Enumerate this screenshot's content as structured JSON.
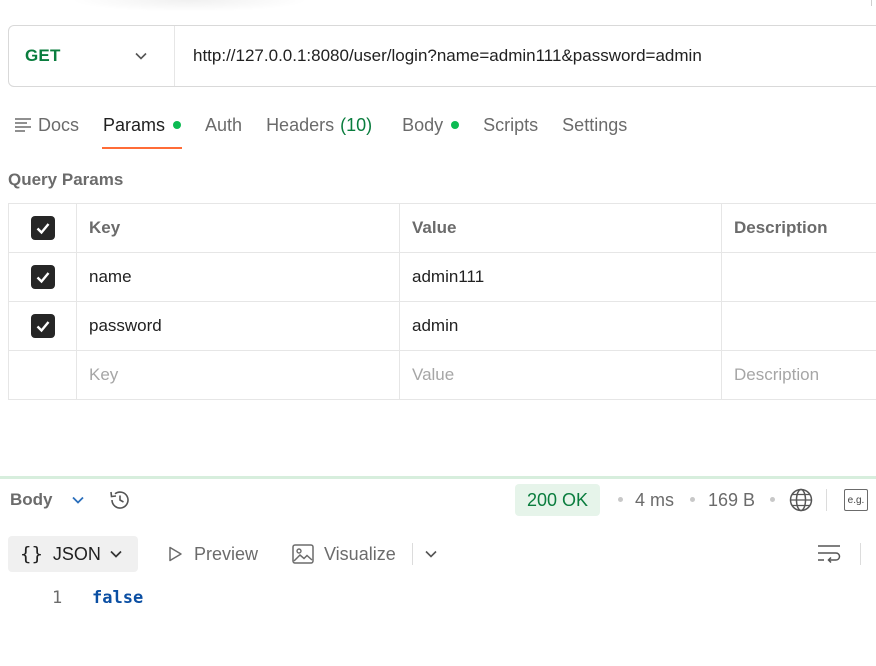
{
  "request": {
    "method": "GET",
    "url": "http://127.0.0.1:8080/user/login?name=admin111&password=admin"
  },
  "tabs": [
    {
      "label": "Docs"
    },
    {
      "label": "Params"
    },
    {
      "label": "Auth"
    },
    {
      "label": "Headers",
      "count": "(10)"
    },
    {
      "label": "Body"
    },
    {
      "label": "Scripts"
    },
    {
      "label": "Settings"
    }
  ],
  "active_tab": "Params",
  "query_params": {
    "title": "Query Params",
    "headers": {
      "key": "Key",
      "value": "Value",
      "description": "Description"
    },
    "rows": [
      {
        "key": "name",
        "value": "admin111",
        "description": "",
        "checked": true
      },
      {
        "key": "password",
        "value": "admin",
        "description": "",
        "checked": true
      }
    ],
    "placeholder": {
      "key": "Key",
      "value": "Value",
      "description": "Description"
    }
  },
  "response": {
    "label": "Body",
    "status": "200 OK",
    "time": "4 ms",
    "size": "169 B",
    "format": "JSON",
    "preview_label": "Preview",
    "visualize_label": "Visualize",
    "example_label": "e.g.",
    "lines": [
      {
        "number": "1",
        "text": "false"
      }
    ]
  },
  "colors": {
    "method_green": "#0a7d3e",
    "active_tab_underline": "#ff6c37",
    "status_dot": "#0cbb52",
    "status_pill_bg": "#e6f4ea",
    "json_literal": "#0b4fa3"
  }
}
